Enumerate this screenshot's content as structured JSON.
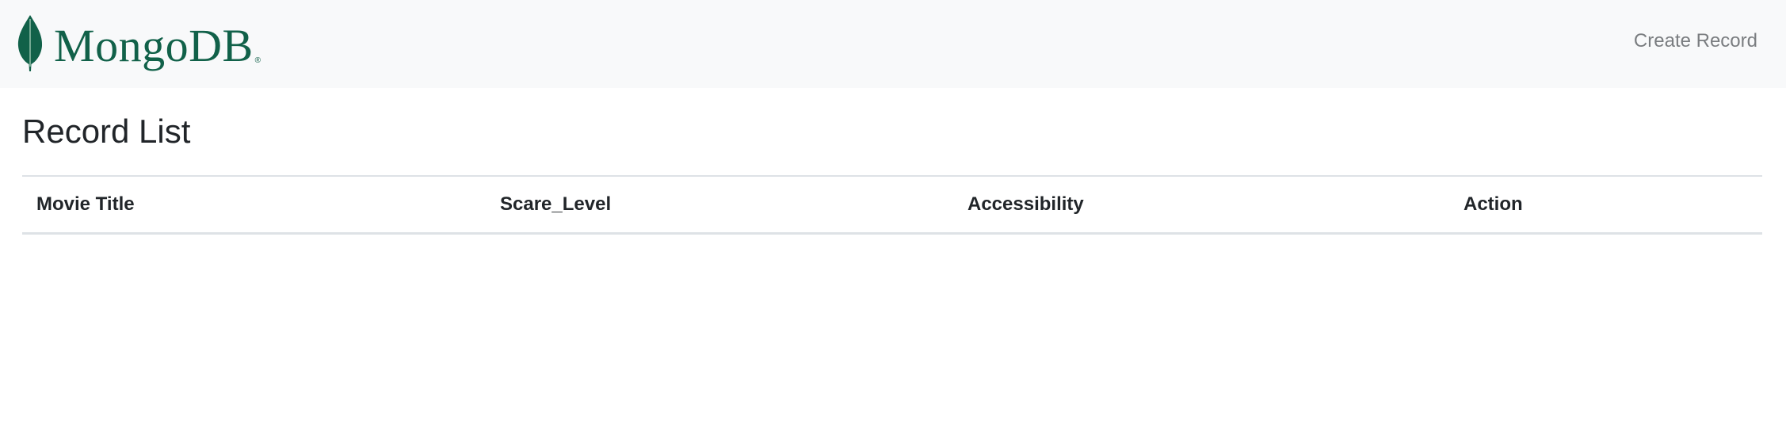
{
  "navbar": {
    "brand": {
      "name": "MongoDB",
      "registered_mark": "®",
      "leaf_color": "#116149",
      "text_color": "#116149"
    },
    "create_link_label": "Create Record",
    "background": "#f8f9fa"
  },
  "page": {
    "title": "Record List"
  },
  "table": {
    "columns": [
      {
        "label": "Movie Title"
      },
      {
        "label": "Scare_Level"
      },
      {
        "label": "Accessibility"
      },
      {
        "label": "Action"
      }
    ],
    "rows": []
  }
}
